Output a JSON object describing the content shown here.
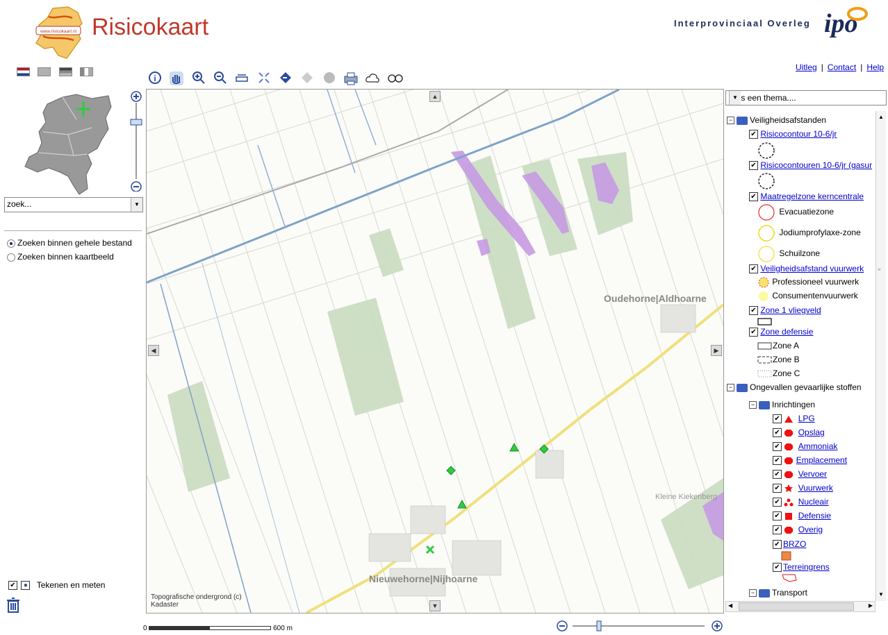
{
  "header": {
    "logo_url_text": "www.risicokaart.nl",
    "title": "Risicokaart",
    "partner_text": "Interprovinciaal Overleg",
    "partner_logo": "ipo"
  },
  "top_links": [
    "Uitleg",
    "Contact",
    "Help"
  ],
  "flags": [
    "flag-nl-icon",
    "flag-uk-icon",
    "flag-de-icon",
    "flag-fr-icon"
  ],
  "toolbar": [
    "info-icon",
    "pan-hand-icon",
    "zoom-in-icon",
    "zoom-out-icon",
    "measure-icon",
    "full-extent-icon",
    "back-icon",
    "forward-icon",
    "clear-icon",
    "print-icon",
    "cloud-icon",
    "link-icon"
  ],
  "search": {
    "value": "zoek..."
  },
  "search_options": {
    "option1": "Zoeken binnen gehele bestand",
    "option2": "Zoeken binnen kaartbeeld",
    "selected": "option1"
  },
  "drawing": {
    "label": "Tekenen en meten"
  },
  "map": {
    "labels": {
      "oudehorne": "Oudehorne|Aldhoarne",
      "nieuwehorne": "Nieuwehorne|Nijhoarne",
      "kleine": "Kleine Kiekenberg"
    },
    "attribution_line1": "Topografische ondergrond (c)",
    "attribution_line2": "Kadaster"
  },
  "scale_bar": {
    "start": "0",
    "end": "600 m"
  },
  "theme_select": {
    "value": "Kies een thema...."
  },
  "legend": {
    "group1": "Veiligheidsafstanden",
    "risicocontour": "Risicocontour 10-6/jr",
    "risicocontouren": "Risicocontouren 10-6/jr (gasur",
    "maatregelzone": "Maatregelzone kerncentrale",
    "evacuatiezone": "Evacuatiezone",
    "jodium": "Jodiumprofylaxe-zone",
    "schuilzone": "Schuilzone",
    "vuurwerk_afstand": "Veiligheidsafstand vuurwerk",
    "prof_vuurwerk": "Professioneel vuurwerk",
    "cons_vuurwerk": "Consumentenvuurwerk",
    "zone1": "Zone 1 vliegveld",
    "zone_defensie": "Zone defensie",
    "zone_a": "Zone A",
    "zone_b": "Zone B",
    "zone_c": "Zone C",
    "group2": "Ongevallen gevaarlijke stoffen",
    "inrichtingen": "Inrichtingen",
    "lpg": "LPG",
    "opslag": "Opslag",
    "ammoniak": "Ammoniak",
    "emplacement": "Emplacement",
    "vervoer": "Vervoer",
    "vuurwerk": "Vuurwerk",
    "nucleair": "Nucleair",
    "defensie": "Defensie",
    "overig": "Overig",
    "brzo": "BRZO",
    "terreingrens": "Terreingrens",
    "transport": "Transport"
  }
}
